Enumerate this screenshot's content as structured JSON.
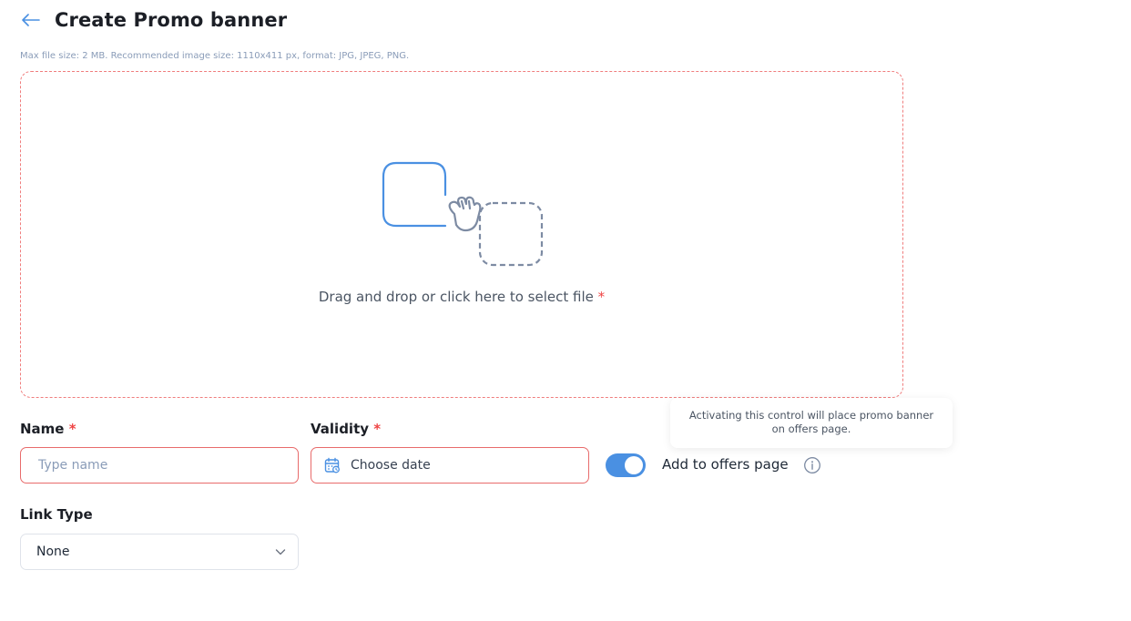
{
  "header": {
    "title": "Create Promo banner",
    "back_icon": "arrow-left-icon"
  },
  "upload": {
    "hint": "Max file size: 2 MB. Recommended image size: 1110x411 px, format: JPG, JPEG, PNG.",
    "prompt": "Drag and drop or click here to select file",
    "required_mark": "*",
    "illustration_icon": "drag-and-drop-hand-icon"
  },
  "form": {
    "name": {
      "label": "Name",
      "required_mark": "*",
      "placeholder": "Type name",
      "value": ""
    },
    "validity": {
      "label": "Validity",
      "required_mark": "*",
      "value": "Choose date",
      "icon": "calendar-icon"
    },
    "offers_toggle": {
      "label": "Add to offers page",
      "on": true,
      "info_icon": "info-icon"
    },
    "tooltip": {
      "text": "Activating this control will place promo banner on offers page."
    },
    "link_type": {
      "label": "Link Type",
      "value": "None",
      "icon": "chevron-down-icon"
    }
  },
  "colors": {
    "accent": "#4a90e2",
    "error_border": "#e86b6b",
    "required": "#ef4444",
    "hint_text": "#8a9cb8"
  }
}
